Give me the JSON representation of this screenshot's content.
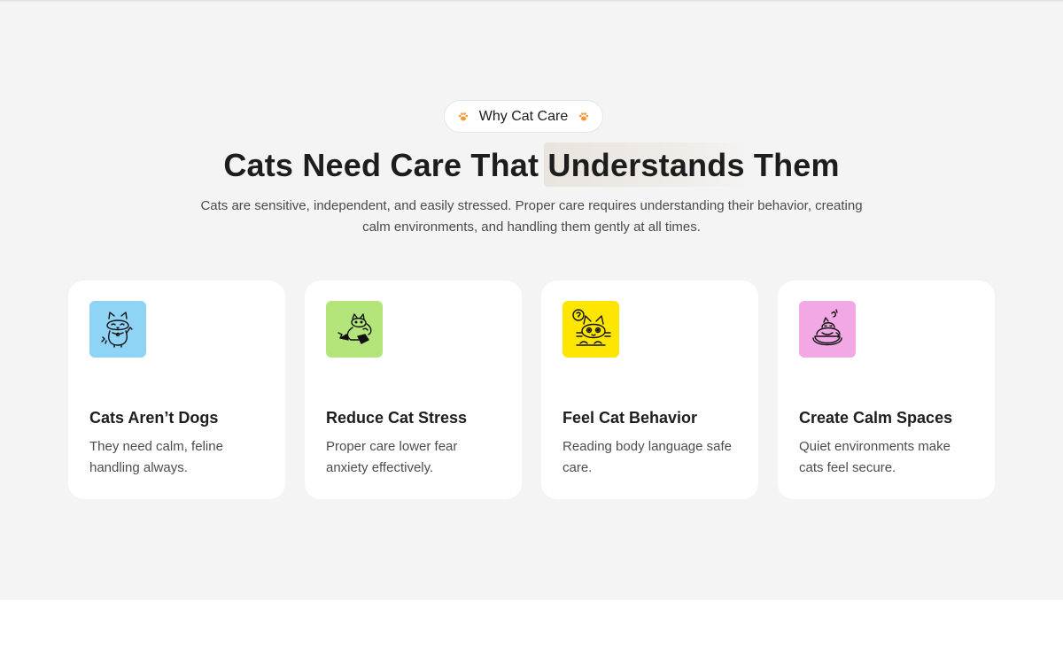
{
  "badge": {
    "label": "Why Cat Care",
    "left_icon": "paw-icon",
    "right_icon": "paw-icon",
    "accent_color": "#f5983a"
  },
  "headline": {
    "before": "Cats Need Care That ",
    "highlight": "Understands",
    "after": " Them"
  },
  "subtitle": "Cats are sensitive, independent, and easily stressed. Proper care requires understanding their behavior, creating calm environments, and handling them gently at all times.",
  "cards": [
    {
      "title": "Cats Aren’t Dogs",
      "description": "They need calm, feline handling always.",
      "icon": "lucky-cat-icon",
      "icon_bg": "#8fd3f5"
    },
    {
      "title": "Reduce Cat Stress",
      "description": "Proper care lower fear anxiety effectively.",
      "icon": "playful-cat-icon",
      "icon_bg": "#b3e57a"
    },
    {
      "title": "Feel Cat Behavior",
      "description": "Reading body language safe care.",
      "icon": "curious-cat-icon",
      "icon_bg": "#ffe600"
    },
    {
      "title": "Create Calm Spaces",
      "description": "Quiet environments make cats feel secure.",
      "icon": "sleeping-cat-icon",
      "icon_bg": "#f1a8e4"
    }
  ]
}
